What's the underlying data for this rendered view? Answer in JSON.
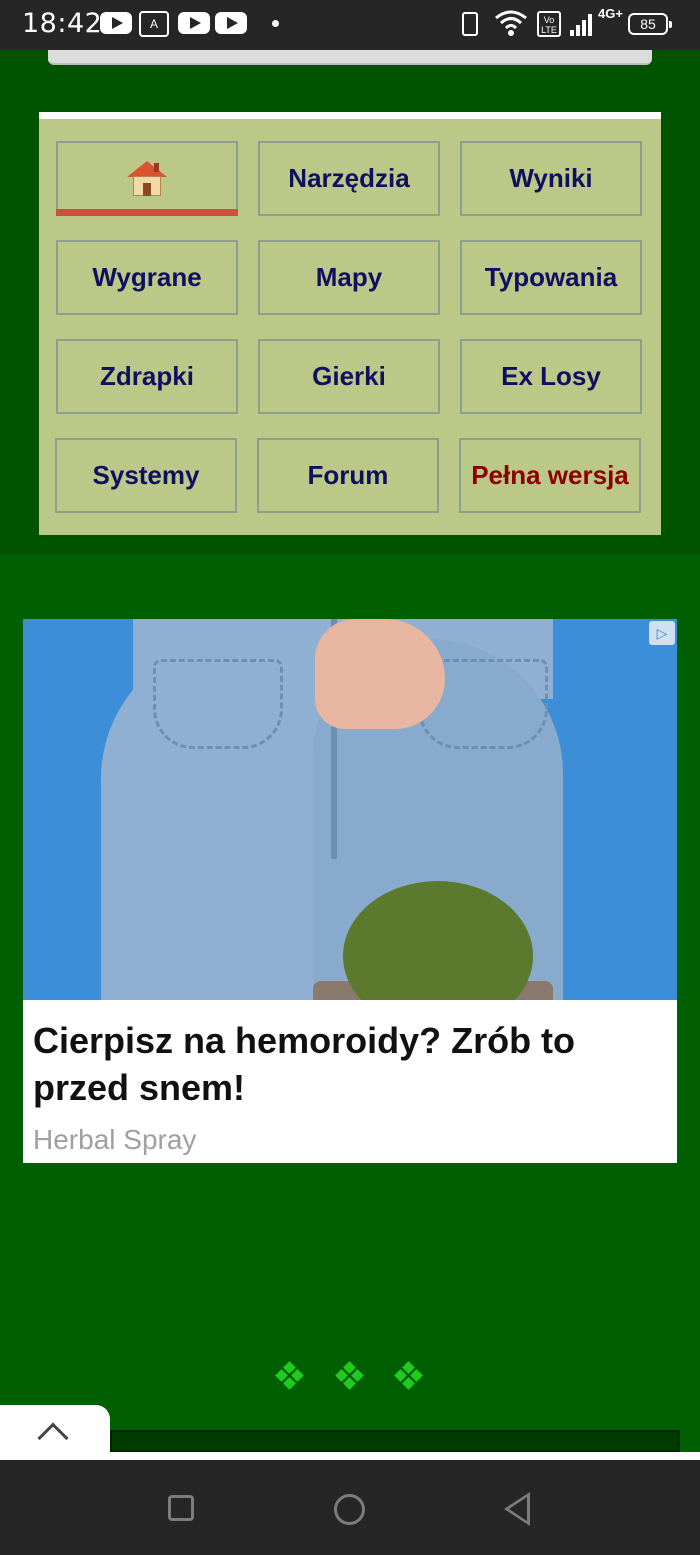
{
  "status_bar": {
    "time": "18:42",
    "network": "4G+",
    "volte": "Vo LTE",
    "battery": "85",
    "icons": [
      "youtube-icon",
      "translate-icon",
      "youtube-icon",
      "youtube-icon",
      "notification-dot",
      "vibrate-icon",
      "wifi-icon",
      "volte-icon",
      "signal-icon",
      "battery-icon"
    ]
  },
  "menu": {
    "home_icon": "house-icon",
    "items": [
      {
        "label": "Narzędzia"
      },
      {
        "label": "Wyniki"
      },
      {
        "label": "Wygrane"
      },
      {
        "label": "Mapy"
      },
      {
        "label": "Typowania"
      },
      {
        "label": "Zdrapki"
      },
      {
        "label": "Gierki"
      },
      {
        "label": "Ex Losy"
      },
      {
        "label": "Systemy"
      },
      {
        "label": "Forum"
      },
      {
        "label": "Pełna wersja"
      }
    ],
    "accent_color": "#c8523a",
    "text_color": "#101060",
    "highlight_color": "#8b0000"
  },
  "ad": {
    "headline": "Cierpisz na hemoroidy? Zrób to przed snem!",
    "source": "Herbal Spray",
    "adchoices_icon": "adchoices-icon"
  },
  "footer": {
    "scroll_top_icon": "chevron-up-icon"
  },
  "nav": {
    "icons": [
      "recent-apps-icon",
      "home-icon",
      "back-icon"
    ]
  }
}
